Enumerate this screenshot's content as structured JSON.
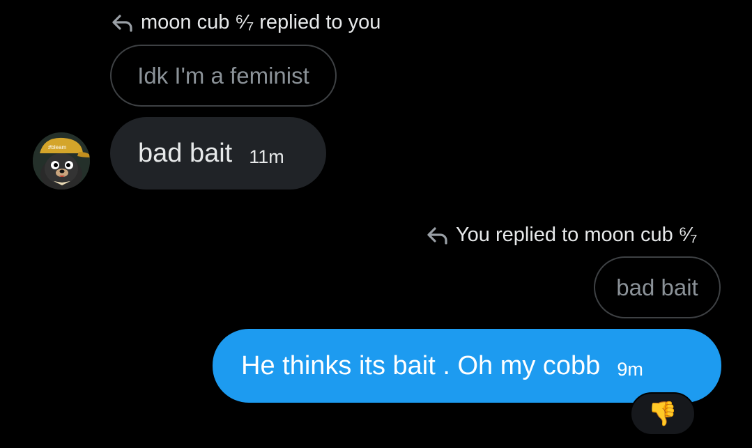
{
  "thread": [
    {
      "direction": "incoming",
      "reply_header": "moon cub ⁶⁄₇ replied to you",
      "quoted_text": "Idk I'm a feminist",
      "message": "bad bait",
      "time": "11m",
      "avatar_badge": "#bleam"
    },
    {
      "direction": "outgoing",
      "reply_header": "You replied to moon cub ⁶⁄₇",
      "quoted_text": "bad bait",
      "message": "He thinks its bait . Oh my cobb",
      "time": "9m",
      "reaction": "👎"
    }
  ],
  "colors": {
    "background": "#000000",
    "incoming_bubble": "#202327",
    "outgoing_bubble": "#1d9bf0",
    "quoted_border": "#3e4144",
    "quoted_text": "#8b9298"
  },
  "icons": {
    "reply": "reply-arrow-icon",
    "avatar": "bear-avatar-icon"
  }
}
